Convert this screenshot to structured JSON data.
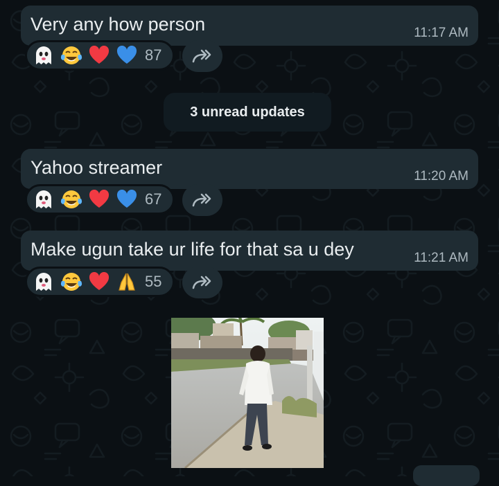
{
  "theme": {
    "background": "#0b1014",
    "bubble": "#1f2c33",
    "text": "#e9edef",
    "meta": "#aebac1"
  },
  "messages": [
    {
      "text": "Very any how person",
      "time": "11:17 AM",
      "reactions": [
        "ghost-icon",
        "tears-of-joy-icon",
        "red-heart-icon",
        "blue-heart-icon"
      ],
      "count": "87"
    },
    {
      "text": "Yahoo streamer",
      "time": "11:20 AM",
      "reactions": [
        "ghost-icon",
        "tears-of-joy-icon",
        "red-heart-icon",
        "blue-heart-icon"
      ],
      "count": "67"
    },
    {
      "text": "Make ugun take ur life for that sa u dey",
      "time": "11:21 AM",
      "reactions": [
        "ghost-icon",
        "tears-of-joy-icon",
        "red-heart-icon",
        "folded-hands-icon"
      ],
      "count": "55"
    }
  ],
  "unread_divider": "3 unread updates",
  "icons": {
    "forward": "forward-icon"
  }
}
